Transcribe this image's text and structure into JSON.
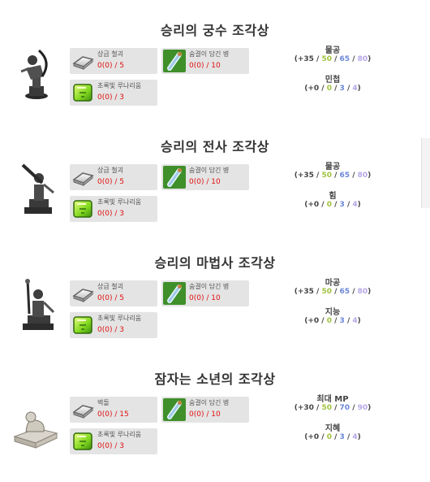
{
  "sections": [
    {
      "title": "승리의 궁수 조각상",
      "materials": [
        {
          "name": "상급 철괴",
          "count": "0(0) / 5",
          "icon": "iron-ingot-icon"
        },
        {
          "name": "숨결이 담긴 병",
          "count": "0(0) / 10",
          "icon": "breath-bottle-icon"
        },
        {
          "name": "초록빛 루나리움",
          "count": "0(0) / 3",
          "icon": "green-lunarium-icon"
        }
      ],
      "stats": [
        {
          "name": "물공",
          "vals": [
            "+35",
            "50",
            "65",
            "80"
          ]
        },
        {
          "name": "민첩",
          "vals": [
            "+0",
            "0",
            "3",
            "4"
          ]
        }
      ]
    },
    {
      "title": "승리의 전사 조각상",
      "materials": [
        {
          "name": "상급 철괴",
          "count": "0(0) / 5",
          "icon": "iron-ingot-icon"
        },
        {
          "name": "숨결이 담긴 병",
          "count": "0(0) / 10",
          "icon": "breath-bottle-icon"
        },
        {
          "name": "초록빛 루나리움",
          "count": "0(0) / 3",
          "icon": "green-lunarium-icon"
        }
      ],
      "stats": [
        {
          "name": "물공",
          "vals": [
            "+35",
            "50",
            "65",
            "80"
          ]
        },
        {
          "name": "힘",
          "vals": [
            "+0",
            "0",
            "3",
            "4"
          ]
        }
      ]
    },
    {
      "title": "승리의 마법사 조각상",
      "materials": [
        {
          "name": "상급 철괴",
          "count": "0(0) / 5",
          "icon": "iron-ingot-icon"
        },
        {
          "name": "숨결이 담긴 병",
          "count": "0(0) / 10",
          "icon": "breath-bottle-icon"
        },
        {
          "name": "초록빛 루나리움",
          "count": "0(0) / 3",
          "icon": "green-lunarium-icon"
        }
      ],
      "stats": [
        {
          "name": "마공",
          "vals": [
            "+35",
            "50",
            "65",
            "80"
          ]
        },
        {
          "name": "지능",
          "vals": [
            "+0",
            "0",
            "3",
            "4"
          ]
        }
      ]
    },
    {
      "title": "잠자는 소년의 조각상",
      "materials": [
        {
          "name": "벽돌",
          "count": "0(0) / 15",
          "icon": "brick-icon"
        },
        {
          "name": "숨결이 담긴 병",
          "count": "0(0) / 10",
          "icon": "breath-bottle-icon"
        },
        {
          "name": "초록빛 루나리움",
          "count": "0(0) / 3",
          "icon": "green-lunarium-icon"
        }
      ],
      "stats": [
        {
          "name": "최대 MP",
          "vals": [
            "+30",
            "50",
            "70",
            "90"
          ]
        },
        {
          "name": "지혜",
          "vals": [
            "+0",
            "0",
            "3",
            "4"
          ]
        }
      ]
    }
  ],
  "colors": {
    "tier1": "#444444",
    "tier2": "#9fc33c",
    "tier3": "#6a86d9",
    "tier4": "#b6a6e6",
    "count_red": "#e01010",
    "material_bg": "#e4e4e4"
  }
}
